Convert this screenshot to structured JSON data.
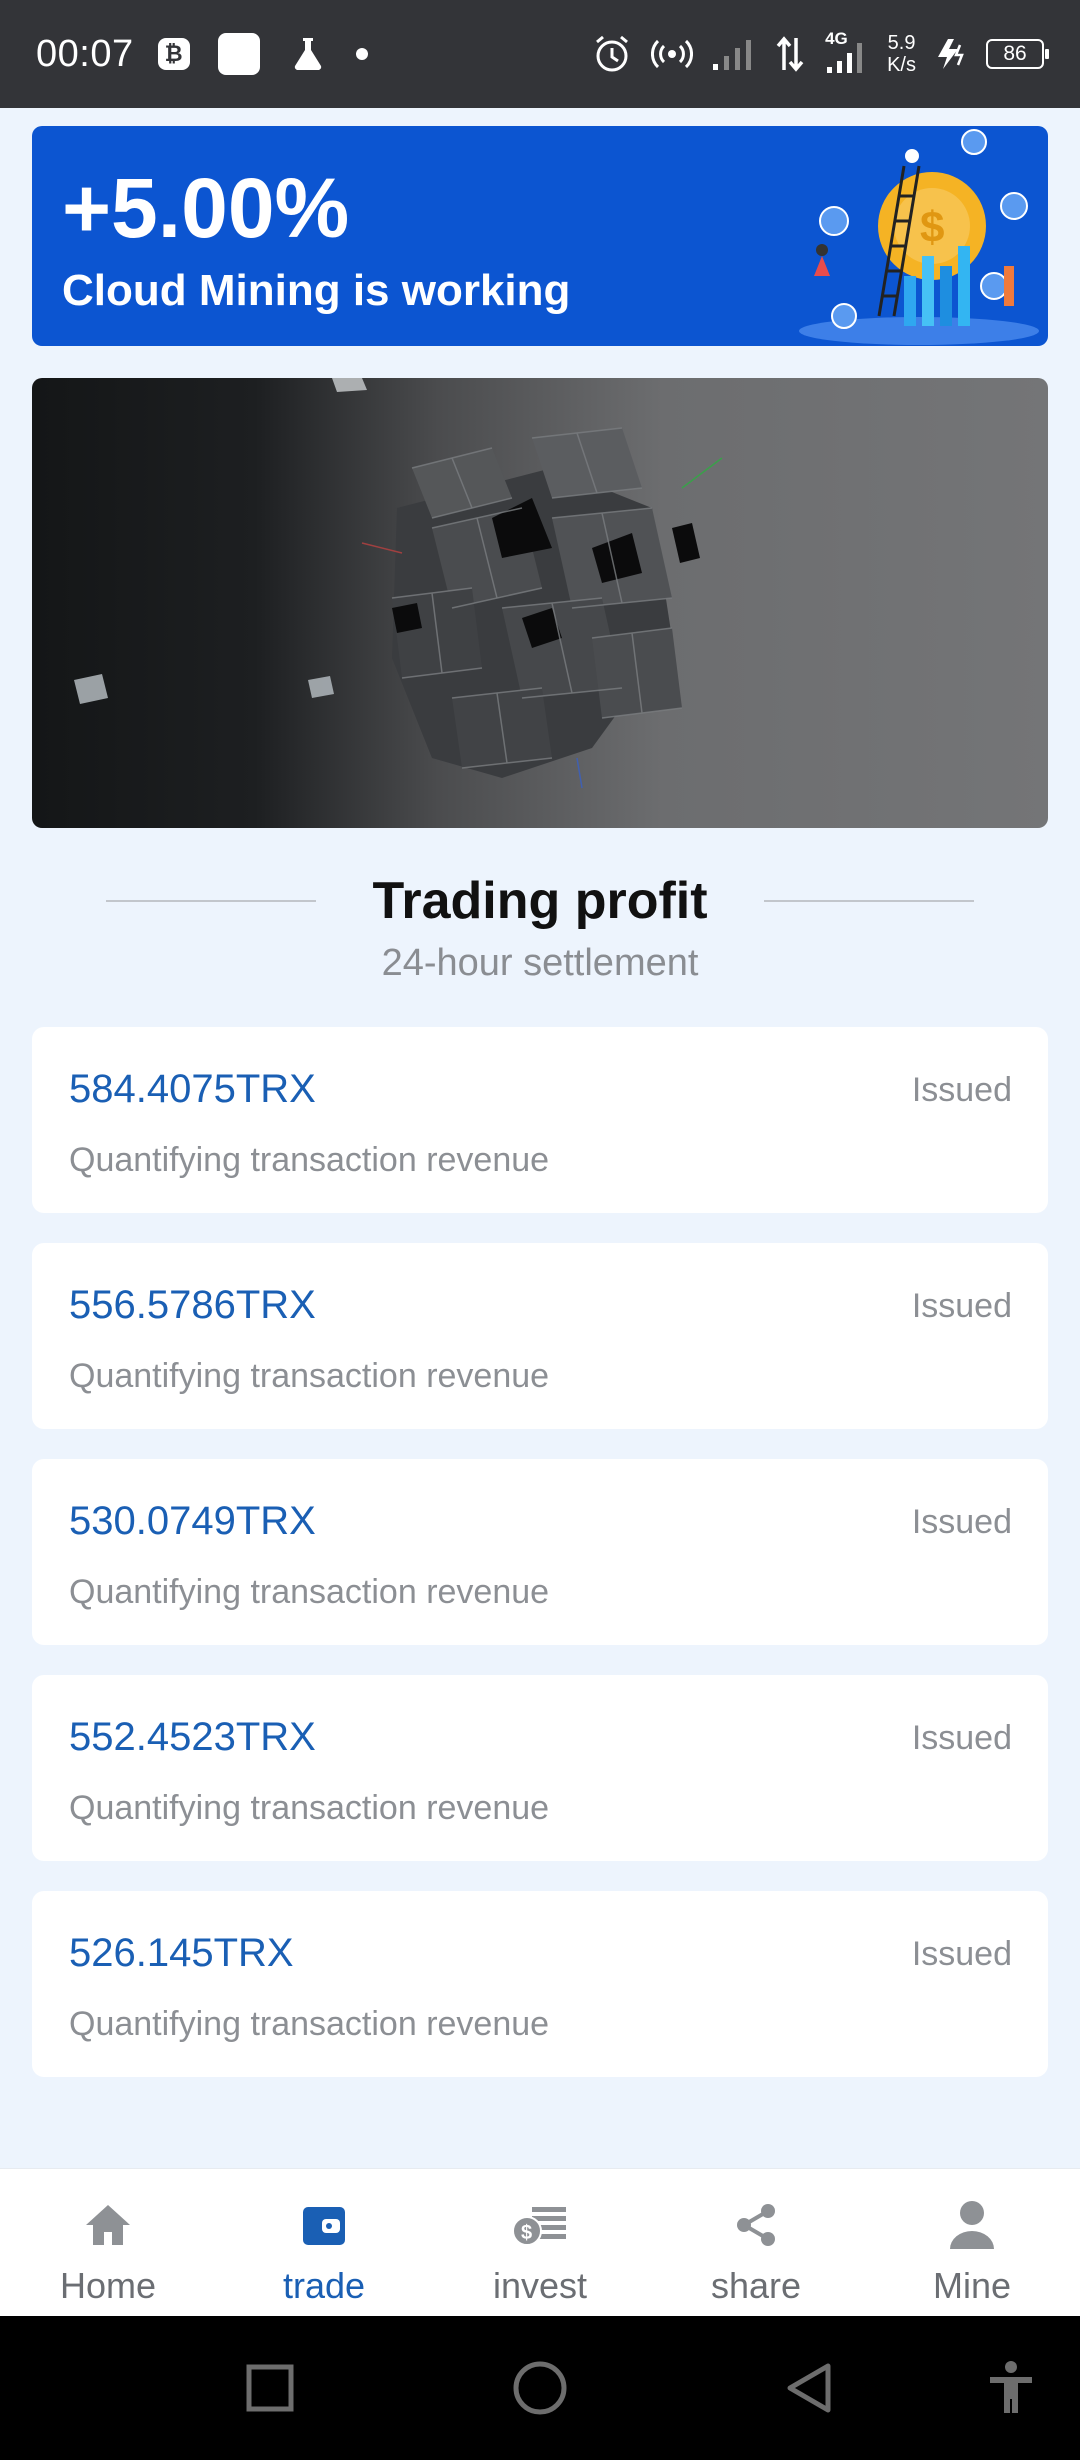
{
  "status_bar": {
    "time": "00:07",
    "speed_value": "5.9",
    "speed_unit": "K/s",
    "network": "4G",
    "battery": "86"
  },
  "banner": {
    "rate": "+5.00%",
    "text": "Cloud Mining is working"
  },
  "section": {
    "title": "Trading profit",
    "subtitle": "24-hour settlement"
  },
  "profits": [
    {
      "amount": "584.4075TRX",
      "description": "Quantifying transaction revenue",
      "status": "Issued"
    },
    {
      "amount": "556.5786TRX",
      "description": "Quantifying transaction revenue",
      "status": "Issued"
    },
    {
      "amount": "530.0749TRX",
      "description": "Quantifying transaction revenue",
      "status": "Issued"
    },
    {
      "amount": "552.4523TRX",
      "description": "Quantifying transaction revenue",
      "status": "Issued"
    },
    {
      "amount": "526.145TRX",
      "description": "Quantifying transaction revenue",
      "status": "Issued"
    }
  ],
  "bottom_nav": {
    "items": [
      {
        "label": "Home",
        "icon": "home-icon",
        "active": false
      },
      {
        "label": "trade",
        "icon": "wallet-icon",
        "active": true
      },
      {
        "label": "invest",
        "icon": "money-stack-icon",
        "active": false
      },
      {
        "label": "share",
        "icon": "share-icon",
        "active": false
      },
      {
        "label": "Mine",
        "icon": "user-icon",
        "active": false
      }
    ]
  },
  "colors": {
    "accent": "#1a5fb4",
    "banner": "#0c55d1",
    "background": "#edf4fd"
  }
}
